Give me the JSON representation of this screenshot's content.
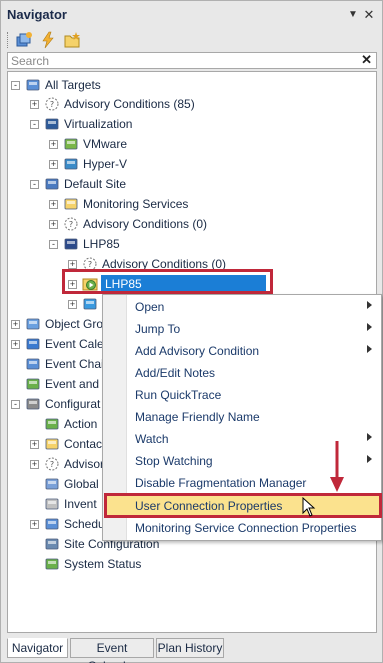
{
  "panel": {
    "title": "Navigator"
  },
  "toolbar": {
    "tools": [
      "targets-add-icon",
      "lightning-icon",
      "folder-star-icon"
    ]
  },
  "search": {
    "placeholder": "Search"
  },
  "tree": {
    "nodes": [
      {
        "label": "All Targets",
        "icon": "all-targets-icon",
        "expander": "-"
      },
      {
        "label": "Advisory Conditions (85)",
        "icon": "advisory-icon",
        "expander": "+"
      },
      {
        "label": "Virtualization",
        "icon": "monitor-icon",
        "expander": "-"
      },
      {
        "label": "VMware",
        "icon": "vmware-icon",
        "expander": "+"
      },
      {
        "label": "Hyper-V",
        "icon": "hyperv-icon",
        "expander": "+"
      },
      {
        "label": "Default Site",
        "icon": "site-icon",
        "expander": "-"
      },
      {
        "label": "Monitoring Services",
        "icon": "folder-icon",
        "expander": "+"
      },
      {
        "label": "Advisory Conditions (0)",
        "icon": "advisory-icon",
        "expander": "+"
      },
      {
        "label": "LHP85",
        "icon": "server-icon",
        "expander": "-"
      },
      {
        "label": "Advisory Conditions (0)",
        "icon": "advisory-icon",
        "expander": "+"
      },
      {
        "label": "LHP85",
        "icon": "sql-target-icon",
        "expander": "+"
      },
      {
        "label": "",
        "icon": "sql-target-2-icon",
        "expander": "+"
      },
      {
        "label": "Object Gro",
        "icon": "object-groups-icon",
        "expander": "+"
      },
      {
        "label": "Event Cale",
        "icon": "event-calendar-icon",
        "expander": "+"
      },
      {
        "label": "Event Chai",
        "icon": "event-chain-icon",
        "expander": ""
      },
      {
        "label": "Event and",
        "icon": "event-alerts-icon",
        "expander": ""
      },
      {
        "label": "Configurat",
        "icon": "configuration-icon",
        "expander": "-"
      },
      {
        "label": "Action",
        "icon": "action-icon",
        "expander": ""
      },
      {
        "label": "Contac",
        "icon": "contacts-icon",
        "expander": "+"
      },
      {
        "label": "Advisor",
        "icon": "advisory-icon",
        "expander": "+"
      },
      {
        "label": "Global",
        "icon": "checklist-icon",
        "expander": ""
      },
      {
        "label": "Invent",
        "icon": "inventory-icon",
        "expander": ""
      },
      {
        "label": "Schedu",
        "icon": "schedule-icon",
        "expander": "+"
      },
      {
        "label": "Site Configuration",
        "icon": "site-config-icon",
        "expander": ""
      },
      {
        "label": "System Status",
        "icon": "system-status-icon",
        "expander": ""
      }
    ]
  },
  "context_menu": {
    "items": [
      {
        "label": "Open",
        "submenu": true
      },
      {
        "label": "Jump To",
        "submenu": true
      },
      {
        "label": "Add Advisory Condition",
        "submenu": true
      },
      {
        "label": "Add/Edit Notes",
        "submenu": false
      },
      {
        "label": "Run QuickTrace",
        "submenu": false
      },
      {
        "label": "Manage Friendly Name",
        "submenu": false
      },
      {
        "label": "Watch",
        "submenu": true
      },
      {
        "label": "Stop Watching",
        "submenu": true
      },
      {
        "label": "Disable Fragmentation Manager",
        "submenu": false
      },
      {
        "label": "User Connection Properties",
        "submenu": false,
        "highlighted": true
      },
      {
        "label": "Monitoring Service Connection Properties",
        "submenu": false
      }
    ]
  },
  "tabs": [
    {
      "label": "Navigator",
      "active": true
    },
    {
      "label": "Event Calendar",
      "active": false
    },
    {
      "label": "Plan History",
      "active": false
    }
  ],
  "colors": {
    "selection": "#1b7ed6",
    "highlight_box": "#c0283a",
    "menu_hover": "#fbe28e",
    "annotation_arrow": "#c0283a"
  }
}
